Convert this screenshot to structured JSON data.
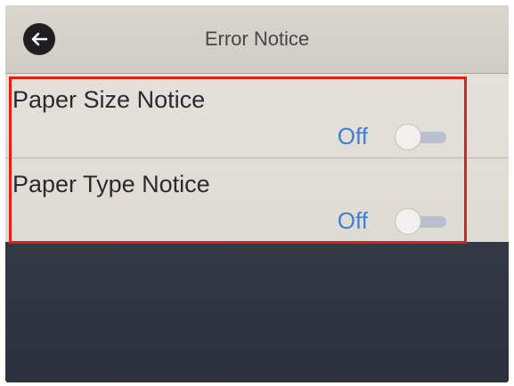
{
  "header": {
    "title": "Error Notice",
    "back_icon": "arrow-left-icon"
  },
  "settings": [
    {
      "label": "Paper Size Notice",
      "value": "Off",
      "enabled": false
    },
    {
      "label": "Paper Type Notice",
      "value": "Off",
      "enabled": false
    }
  ],
  "colors": {
    "accent": "#3f7fd4",
    "highlight_border": "#e0201b"
  }
}
